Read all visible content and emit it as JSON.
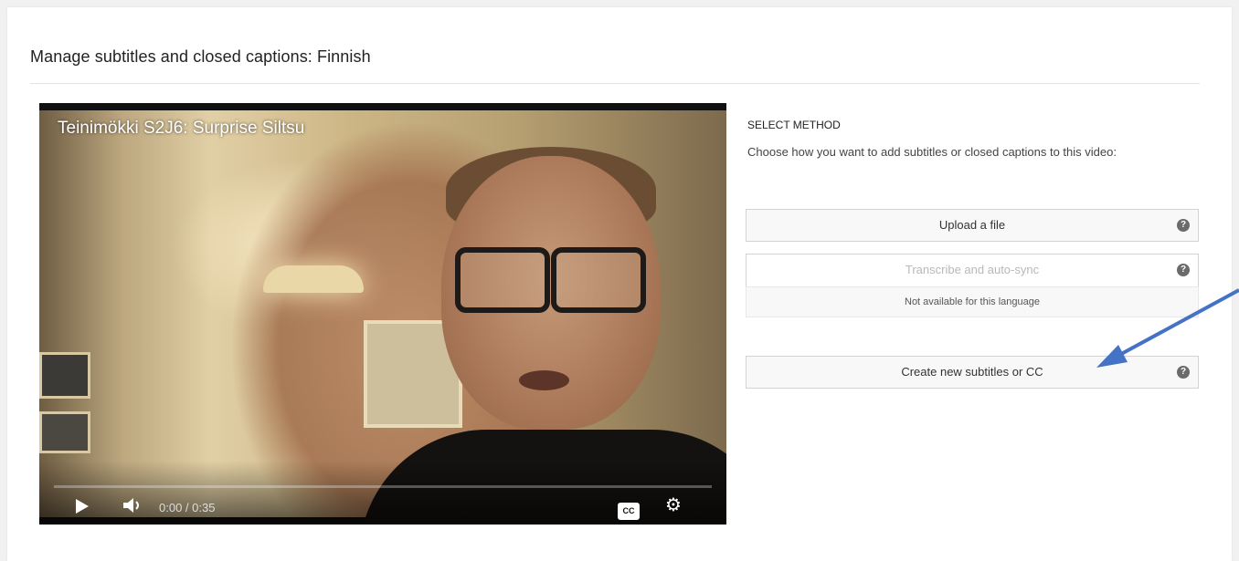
{
  "page": {
    "title": "Manage subtitles and closed captions: Finnish"
  },
  "player": {
    "video_title": "Teinimökki S2J6: Surprise Siltsu",
    "time": "0:00 / 0:35",
    "cc_label": "CC",
    "progress_fraction": 0
  },
  "method": {
    "heading": "SELECT METHOD",
    "description": "Choose how you want to add subtitles or closed captions to this video:",
    "options": [
      {
        "label": "Upload a file",
        "enabled": true,
        "help": "?"
      },
      {
        "label": "Transcribe and auto-sync",
        "enabled": false,
        "help": "?",
        "note": "Not available for this language"
      },
      {
        "label": "Create new subtitles or CC",
        "enabled": true,
        "help": "?"
      }
    ]
  },
  "colors": {
    "annotation_arrow": "#4472c4",
    "progress": "#ff0000"
  },
  "icons": {
    "play": "play-icon",
    "volume": "volume-icon",
    "cc": "cc-icon",
    "settings": "gear-icon",
    "help": "help-icon"
  }
}
